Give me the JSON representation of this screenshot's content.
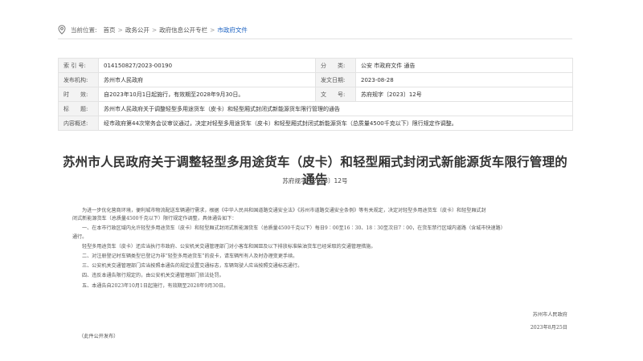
{
  "breadcrumb": {
    "label": "当前位置:",
    "items": [
      "首页",
      "政务公开",
      "政府信息公开专栏"
    ],
    "sep": ">",
    "current": "市政府文件"
  },
  "meta": {
    "index_label": "索 引 号:",
    "index_value": "014150827/2023-00190",
    "category_label": "分　　类:",
    "category_value": "公安 市政府文件 通告",
    "issuer_label": "发布机构:",
    "issuer_value": "苏州市人民政府",
    "date_label": "发文日期:",
    "date_value": "2023-08-28",
    "validity_label": "时　　效:",
    "validity_value": "自2023年10月1日起施行，有效期至2028年9月30日。",
    "docno_label": "文　　号:",
    "docno_value": "苏府规字〔2023〕12号",
    "title_label": "标　　题:",
    "title_value": "苏州市人民政府关于调整轻型多用途货车（皮卡）和轻型厢式封闭式新能源货车限行管理的通告",
    "summary_label": "内容概述:",
    "summary_value": "经市政府第44次常务会议审议通过，决定对轻型多用途货车（皮卡）和轻型厢式封闭式新能源货车（总质量4500千克以下）限行规定作调整。"
  },
  "doc": {
    "title": "苏州市人民政府关于调整轻型多用途货车（皮卡）和轻型厢式封闭式新能源货车限行管理的通告",
    "number": "苏府规字〔2023〕12号",
    "intro_1": "为进一步优化营商环境，便利城市物流配送车辆通行需求，根据《中华人民共和国道路交通安全法》《苏州市道路交通安全条例》等有关规定，决定对轻型多用途货车（皮卡）和轻型厢式封",
    "intro_2": "闭式新能源货车（总质量4500千克以下）限行规定作调整，具体通告如下：",
    "item1_1": "一、在本市行政区域内允许轻型多用途货车（皮卡）和轻型厢式封闭式新能源货车（总质量4500千克以下）每日9∶00至16∶30、18∶30至次日7∶00，在货车禁行区域内道路（含城市快速路）",
    "item1_2": "通行。",
    "item1_3": "轻型多用途货车（皮卡）还应当执行市政府、公安机关交通管理部门对小客车和国Ⅲ及以下排放标准柴油货车已经采取的交通管理措施。",
    "item2": "二、对注册登记时车辆类型已登记为非“轻型多用途货车”的皮卡，请车辆所有人及时办理变更手续。",
    "item3": "三、公安机关交通管理部门应当按照本通告的规定设置交通标志，车辆驾驶人应当按照交通标志通行。",
    "item4": "四、违反本通告限行规定的，由公安机关交通管理部门依法处罚。",
    "item5": "五、本通告自2023年10月1日起施行，有效期至2028年9月30日。",
    "sign_org": "苏州市人民政府",
    "sign_date": "2023年8月25日",
    "footnote": "（此件公开发布）"
  }
}
